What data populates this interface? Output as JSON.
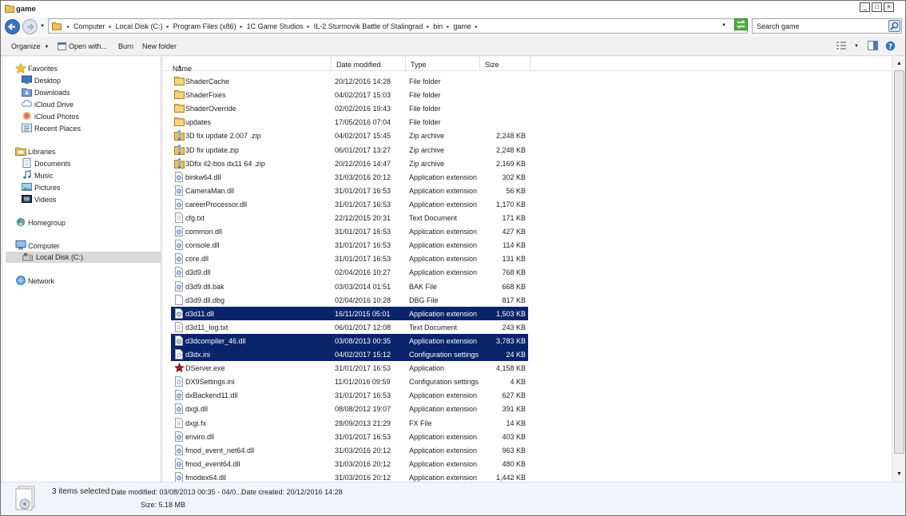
{
  "window": {
    "title": "game",
    "controls": [
      "_",
      "□",
      "×"
    ]
  },
  "address": {
    "crumbs": [
      "Computer",
      "Local Disk (C:)",
      "Program Files (x86)",
      "1C Game Studios",
      "IL-2 Sturmovik Battle of Stalingrad",
      "bin",
      "game"
    ]
  },
  "search": {
    "placeholder": "Search game"
  },
  "toolbar": {
    "organize": "Organize",
    "open_with": "Open with...",
    "burn": "Burn",
    "new_folder": "New folder"
  },
  "nav": {
    "favorites": "Favorites",
    "favorite_items": [
      "Desktop",
      "Downloads",
      "iCloud Drive",
      "iCloud Photos",
      "Recent Places"
    ],
    "libraries": "Libraries",
    "library_items": [
      "Documents",
      "Music",
      "Pictures",
      "Videos"
    ],
    "homegroup": "Homegroup",
    "computer": "Computer",
    "computer_items": [
      "Local Disk (C:)"
    ],
    "network": "Network"
  },
  "columns": {
    "name": "Name",
    "date": "Date modified",
    "type": "Type",
    "size": "Size"
  },
  "files": [
    {
      "name": "ShaderCache",
      "date": "20/12/2016 14:28",
      "type": "File folder",
      "size": "",
      "icon": "folder",
      "selected": false
    },
    {
      "name": "ShaderFixes",
      "date": "04/02/2017 15:03",
      "type": "File folder",
      "size": "",
      "icon": "folder",
      "selected": false
    },
    {
      "name": "ShaderOverride",
      "date": "02/02/2016 19:43",
      "type": "File folder",
      "size": "",
      "icon": "folder",
      "selected": false
    },
    {
      "name": "updates",
      "date": "17/05/2016 07:04",
      "type": "File folder",
      "size": "",
      "icon": "folder",
      "selected": false
    },
    {
      "name": "3D fix update 2.007 .zip",
      "date": "04/02/2017 15:45",
      "type": "Zip archive",
      "size": "2,248 KB",
      "icon": "zip",
      "selected": false
    },
    {
      "name": "3D fix update.zip",
      "date": "06/01/2017 13:27",
      "type": "Zip archive",
      "size": "2,248 KB",
      "icon": "zip",
      "selected": false
    },
    {
      "name": "3Dfix il2-bos dx11 64 .zip",
      "date": "20/12/2016 14:47",
      "type": "Zip archive",
      "size": "2,169 KB",
      "icon": "zip",
      "selected": false
    },
    {
      "name": "binkw64.dll",
      "date": "31/03/2016 20:12",
      "type": "Application extension",
      "size": "302 KB",
      "icon": "dll",
      "selected": false
    },
    {
      "name": "CameraMan.dll",
      "date": "31/01/2017 16:53",
      "type": "Application extension",
      "size": "56 KB",
      "icon": "dll",
      "selected": false
    },
    {
      "name": "careerProcessor.dll",
      "date": "31/01/2017 16:53",
      "type": "Application extension",
      "size": "1,170 KB",
      "icon": "dll",
      "selected": false
    },
    {
      "name": "cfg.txt",
      "date": "22/12/2015 20:31",
      "type": "Text Document",
      "size": "171 KB",
      "icon": "txt",
      "selected": false
    },
    {
      "name": "common.dll",
      "date": "31/01/2017 16:53",
      "type": "Application extension",
      "size": "427 KB",
      "icon": "dll",
      "selected": false
    },
    {
      "name": "console.dll",
      "date": "31/01/2017 16:53",
      "type": "Application extension",
      "size": "114 KB",
      "icon": "dll",
      "selected": false
    },
    {
      "name": "core.dll",
      "date": "31/01/2017 16:53",
      "type": "Application extension",
      "size": "131 KB",
      "icon": "dll",
      "selected": false
    },
    {
      "name": "d3d9.dll",
      "date": "02/04/2016 10:27",
      "type": "Application extension",
      "size": "768 KB",
      "icon": "dll",
      "selected": false
    },
    {
      "name": "d3d9.dll.bak",
      "date": "03/03/2014 01:51",
      "type": "BAK File",
      "size": "668 KB",
      "icon": "dll",
      "selected": false
    },
    {
      "name": "d3d9.dll.dbg",
      "date": "02/04/2016 10:28",
      "type": "DBG File",
      "size": "817 KB",
      "icon": "blank",
      "selected": false
    },
    {
      "name": "d3d11.dll",
      "date": "16/11/2015 05:01",
      "type": "Application extension",
      "size": "1,503 KB",
      "icon": "dll",
      "selected": true
    },
    {
      "name": "d3d11_log.txt",
      "date": "06/01/2017 12:08",
      "type": "Text Document",
      "size": "243 KB",
      "icon": "txt",
      "selected": false
    },
    {
      "name": "d3dcompiler_46.dll",
      "date": "03/08/2013 00:35",
      "type": "Application extension",
      "size": "3,783 KB",
      "icon": "dll",
      "selected": true
    },
    {
      "name": "d3dx.ini",
      "date": "04/02/2017 15:12",
      "type": "Configuration settings",
      "size": "24 KB",
      "icon": "ini",
      "selected": true
    },
    {
      "name": "DServer.exe",
      "date": "31/01/2017 16:53",
      "type": "Application",
      "size": "4,158 KB",
      "icon": "exe",
      "selected": false
    },
    {
      "name": "DX9Settings.ini",
      "date": "11/01/2016 09:59",
      "type": "Configuration settings",
      "size": "4 KB",
      "icon": "ini",
      "selected": false
    },
    {
      "name": "dxBackend11.dll",
      "date": "31/01/2017 16:53",
      "type": "Application extension",
      "size": "627 KB",
      "icon": "dll",
      "selected": false
    },
    {
      "name": "dxgi.dll",
      "date": "08/08/2012 19:07",
      "type": "Application extension",
      "size": "391 KB",
      "icon": "dll",
      "selected": false
    },
    {
      "name": "dxgi.fx",
      "date": "28/09/2013 21:29",
      "type": "FX File",
      "size": "14 KB",
      "icon": "txt",
      "selected": false
    },
    {
      "name": "enviro.dll",
      "date": "31/01/2017 16:53",
      "type": "Application extension",
      "size": "403 KB",
      "icon": "dll",
      "selected": false
    },
    {
      "name": "fmod_event_net64.dll",
      "date": "31/03/2016 20:12",
      "type": "Application extension",
      "size": "963 KB",
      "icon": "dll",
      "selected": false
    },
    {
      "name": "fmod_event64.dll",
      "date": "31/03/2016 20:12",
      "type": "Application extension",
      "size": "480 KB",
      "icon": "dll",
      "selected": false
    },
    {
      "name": "fmodex64.dll",
      "date": "31/03/2016 20:12",
      "type": "Application extension",
      "size": "1,442 KB",
      "icon": "dll",
      "selected": false
    }
  ],
  "details": {
    "selected": "3 items selected",
    "date_modified": "Date modified: 03/08/2013 00:35 - 04/0...",
    "date_created": "Date created: 20/12/2016 14:28",
    "size": "Size: 5.18 MB"
  },
  "colors": {
    "selection": "#0a246a",
    "folder": "#e8c15a",
    "refresh": "#52b043"
  }
}
